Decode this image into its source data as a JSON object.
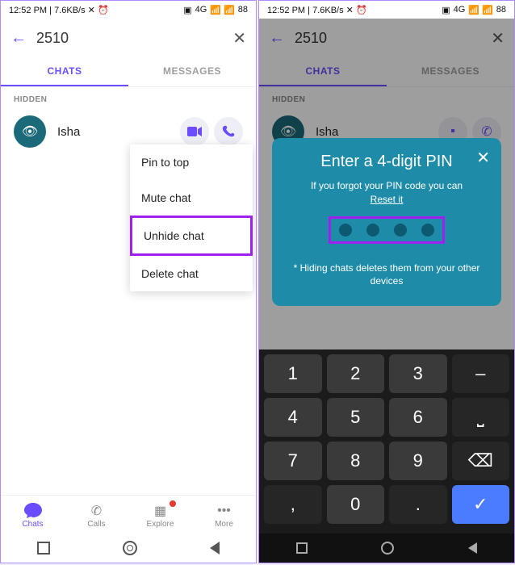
{
  "status": {
    "time": "12:52 PM",
    "net": "7.6KB/s",
    "sig": "4G",
    "batt": "88"
  },
  "search": {
    "query": "2510"
  },
  "tabs": {
    "chats": "CHATS",
    "messages": "MESSAGES"
  },
  "section": "HIDDEN",
  "chat": {
    "name": "Isha"
  },
  "menu": {
    "pin": "Pin to top",
    "mute": "Mute chat",
    "unhide": "Unhide chat",
    "delete": "Delete chat"
  },
  "nav": {
    "chats": "Chats",
    "calls": "Calls",
    "explore": "Explore",
    "more": "More"
  },
  "modal": {
    "title": "Enter a 4-digit PIN",
    "forgot": "If you forgot your PIN code you can",
    "reset": "Reset it",
    "note": "* Hiding chats deletes them from your other devices"
  },
  "keypad": {
    "k1": "1",
    "k2": "2",
    "k3": "3",
    "k4": "4",
    "k5": "5",
    "k6": "6",
    "k7": "7",
    "k8": "8",
    "k9": "9",
    "k0": "0",
    "dot": ".",
    "comma": ","
  }
}
